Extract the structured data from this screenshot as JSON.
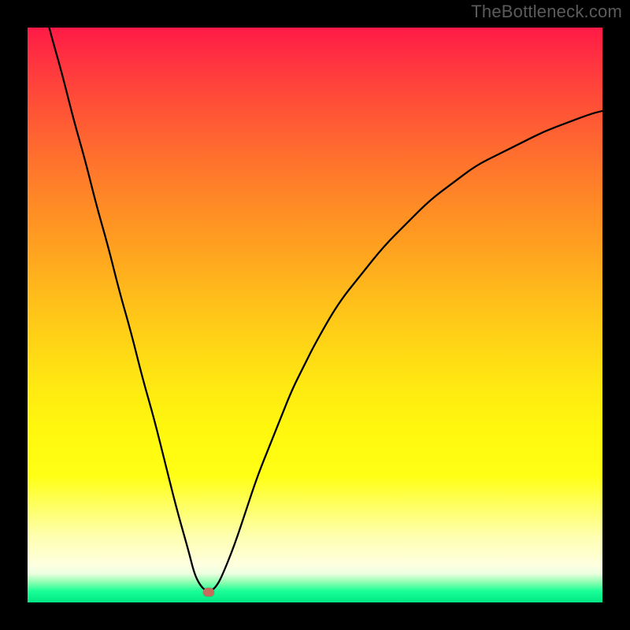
{
  "attribution": "TheBottleneck.com",
  "chart_data": {
    "type": "line",
    "title": "",
    "xlabel": "",
    "ylabel": "",
    "xlim": [
      0,
      100
    ],
    "ylim": [
      0,
      100
    ],
    "x": [
      0,
      2,
      4,
      6,
      8,
      10,
      12,
      14,
      16,
      18,
      20,
      22,
      24,
      26,
      28,
      29,
      30,
      31,
      32,
      33,
      34,
      36,
      38,
      40,
      42,
      44,
      46,
      48,
      50,
      54,
      58,
      62,
      66,
      70,
      74,
      78,
      82,
      86,
      90,
      94,
      98,
      100
    ],
    "values": [
      115,
      107,
      99,
      92,
      84,
      77,
      69,
      62,
      54,
      47,
      39,
      32,
      24,
      16,
      9,
      5,
      3,
      2,
      2,
      3,
      5,
      10,
      16,
      22,
      27,
      32,
      37,
      41,
      45,
      52,
      57,
      62,
      66,
      70,
      73,
      76,
      78,
      80,
      82,
      83.5,
      85,
      85.5
    ],
    "marker": {
      "x": 31.5,
      "y": 1.8
    },
    "gradient_stops": [
      {
        "pos": 0.0,
        "color": "#ff1a46"
      },
      {
        "pos": 0.3,
        "color": "#ff8826"
      },
      {
        "pos": 0.6,
        "color": "#ffe812"
      },
      {
        "pos": 0.88,
        "color": "#feffb0"
      },
      {
        "pos": 0.96,
        "color": "#8cffb0"
      },
      {
        "pos": 1.0,
        "color": "#00e884"
      }
    ]
  }
}
